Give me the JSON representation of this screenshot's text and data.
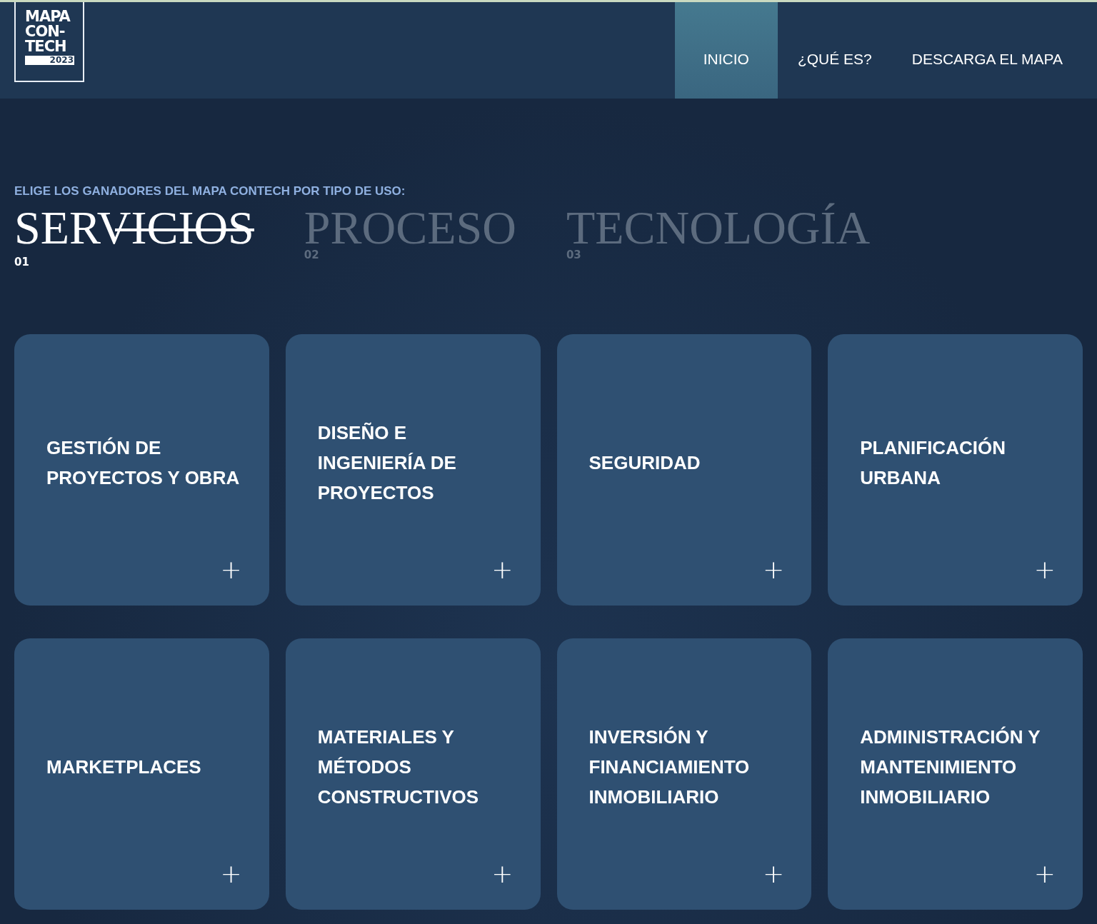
{
  "logo": {
    "lines": [
      "MAPA",
      "CON-",
      "TECH"
    ],
    "year": "2023"
  },
  "nav": [
    {
      "label": "INICIO",
      "selected": true
    },
    {
      "label": "¿QUÉ ES?",
      "selected": false
    },
    {
      "label": "DESCARGA EL MAPA",
      "selected": false
    }
  ],
  "heading": "ELIGE LOS GANADORES DEL MAPA CONTECH POR TIPO DE USO:",
  "tabs": [
    {
      "label": "SERVICIOS",
      "number": "01",
      "selected": true
    },
    {
      "label": "PROCESO",
      "number": "02",
      "selected": false
    },
    {
      "label": "TECNOLOGÍA",
      "number": "03",
      "selected": false
    }
  ],
  "cards": [
    {
      "title": "GESTIÓN DE PROYECTOS Y OBRA",
      "action": "+"
    },
    {
      "title": "DISEÑO E INGENIERÍA DE PROYECTOS",
      "action": "+"
    },
    {
      "title": "SEGURIDAD",
      "action": "+"
    },
    {
      "title": "PLANIFICACIÓN URBANA",
      "action": "+"
    },
    {
      "title": "MARKETPLACES",
      "action": "+"
    },
    {
      "title": "MATERIALES Y MÉTODOS CONSTRUCTIVOS",
      "action": "+"
    },
    {
      "title": "INVERSIÓN Y FINANCIAMIENTO INMOBILIARIO",
      "action": "+"
    },
    {
      "title": "ADMINISTRACIÓN Y MANTENIMIENTO INMOBILIARIO",
      "action": "+"
    }
  ]
}
